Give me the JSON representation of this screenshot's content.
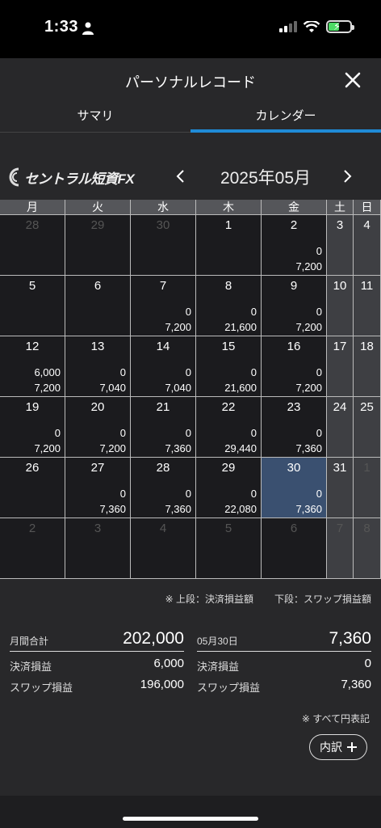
{
  "status": {
    "time": "1:33"
  },
  "header": {
    "title": "パーソナルレコード"
  },
  "tabs": [
    {
      "label": "サマリ",
      "active": false
    },
    {
      "label": "カレンダー",
      "active": true
    }
  ],
  "calendar": {
    "brand": "セントラル短資FX",
    "month": "2025年05月",
    "weekdays": [
      "月",
      "火",
      "水",
      "木",
      "金",
      "土",
      "日"
    ],
    "weeks": [
      [
        {
          "d": "28",
          "other": true
        },
        {
          "d": "29",
          "other": true
        },
        {
          "d": "30",
          "other": true
        },
        {
          "d": "1"
        },
        {
          "d": "2",
          "top": "0",
          "bottom": "7,200"
        },
        {
          "d": "3"
        },
        {
          "d": "4"
        }
      ],
      [
        {
          "d": "5"
        },
        {
          "d": "6"
        },
        {
          "d": "7",
          "top": "0",
          "bottom": "7,200"
        },
        {
          "d": "8",
          "top": "0",
          "bottom": "21,600"
        },
        {
          "d": "9",
          "top": "0",
          "bottom": "7,200"
        },
        {
          "d": "10"
        },
        {
          "d": "11"
        }
      ],
      [
        {
          "d": "12",
          "top": "6,000",
          "bottom": "7,200"
        },
        {
          "d": "13",
          "top": "0",
          "bottom": "7,040"
        },
        {
          "d": "14",
          "top": "0",
          "bottom": "7,040"
        },
        {
          "d": "15",
          "top": "0",
          "bottom": "21,600"
        },
        {
          "d": "16",
          "top": "0",
          "bottom": "7,200"
        },
        {
          "d": "17"
        },
        {
          "d": "18"
        }
      ],
      [
        {
          "d": "19",
          "top": "0",
          "bottom": "7,200"
        },
        {
          "d": "20",
          "top": "0",
          "bottom": "7,200"
        },
        {
          "d": "21",
          "top": "0",
          "bottom": "7,360"
        },
        {
          "d": "22",
          "top": "0",
          "bottom": "29,440"
        },
        {
          "d": "23",
          "top": "0",
          "bottom": "7,360"
        },
        {
          "d": "24"
        },
        {
          "d": "25"
        }
      ],
      [
        {
          "d": "26"
        },
        {
          "d": "27",
          "top": "0",
          "bottom": "7,360"
        },
        {
          "d": "28",
          "top": "0",
          "bottom": "7,360"
        },
        {
          "d": "29",
          "top": "0",
          "bottom": "22,080"
        },
        {
          "d": "30",
          "top": "0",
          "bottom": "7,360",
          "selected": true
        },
        {
          "d": "31"
        },
        {
          "d": "1",
          "other": true
        }
      ],
      [
        {
          "d": "2",
          "other": true
        },
        {
          "d": "3",
          "other": true
        },
        {
          "d": "4",
          "other": true
        },
        {
          "d": "5",
          "other": true
        },
        {
          "d": "6",
          "other": true
        },
        {
          "d": "7",
          "other": true
        },
        {
          "d": "8",
          "other": true
        }
      ]
    ],
    "note_upper": "※ 上段：決済損益額",
    "note_lower": "下段：スワップ損益額"
  },
  "summary_month": {
    "label": "月間合計",
    "total": "202,000",
    "rows": [
      {
        "label": "決済損益",
        "value": "6,000"
      },
      {
        "label": "スワップ損益",
        "value": "196,000"
      }
    ]
  },
  "summary_day": {
    "label": "05月30日",
    "total": "7,360",
    "rows": [
      {
        "label": "決済損益",
        "value": "0"
      },
      {
        "label": "スワップ損益",
        "value": "7,360"
      }
    ]
  },
  "yen_note": "※ すべて円表記",
  "detail_button": "内訳",
  "colors": {
    "accent": "#1f8ad6",
    "selected": "#3a5070",
    "weekend": "#3e3f43"
  }
}
